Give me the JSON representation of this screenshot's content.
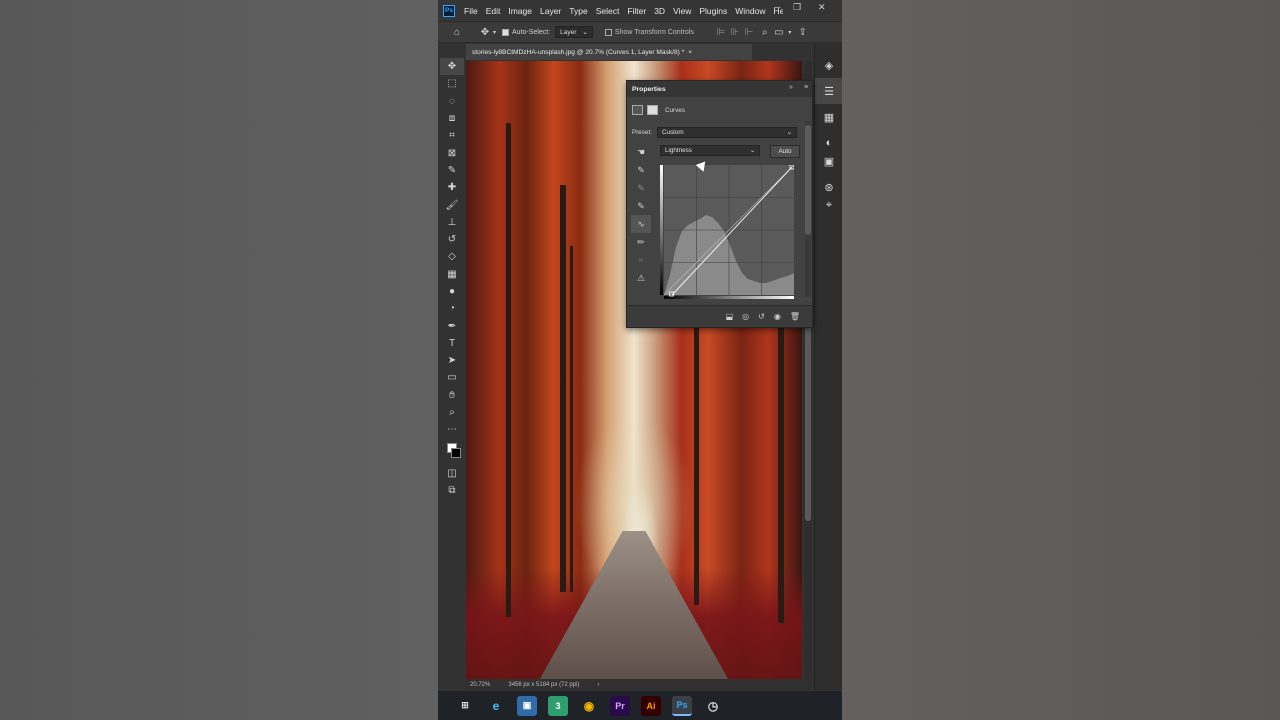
{
  "menubar": {
    "app_logo": "Ps",
    "items": [
      "File",
      "Edit",
      "Image",
      "Layer",
      "Type",
      "Select",
      "Filter",
      "3D",
      "View",
      "Plugins",
      "Window",
      "Help"
    ],
    "minimize": "─",
    "restore": "❐",
    "close": "✕"
  },
  "options": {
    "auto_select_label": "Auto-Select:",
    "auto_select_checked": true,
    "target_value": "Layer",
    "show_transform_label": "Show Transform Controls",
    "show_transform_checked": false
  },
  "document": {
    "tab_title": "stories-ly8BCtMDzHA-unsplash.jpg @ 20.7% (Curves 1, Layer Mask/8) *",
    "close": "×"
  },
  "status": {
    "zoom": "20.72%",
    "dimensions": "3456 px x 5184 px (72 ppi)",
    "arrow": "›"
  },
  "properties": {
    "title": "Properties",
    "panel_label": "Curves",
    "preset_label": "Preset:",
    "preset_value": "Custom",
    "channel_value": "Lightness",
    "auto_label": "Auto"
  },
  "colors": {
    "accent": "#31a8ff",
    "panel_bg": "#424242",
    "window_bg": "#323232"
  },
  "toolbar_icons": [
    "move-icon",
    "marquee-icon",
    "lasso-icon",
    "object-select-icon",
    "crop-icon",
    "frame-icon",
    "eyedropper-icon",
    "healing-icon",
    "brush-icon",
    "stamp-icon",
    "history-brush-icon",
    "eraser-icon",
    "gradient-icon",
    "blur-icon",
    "dodge-icon",
    "pen-icon",
    "type-icon",
    "path-select-icon",
    "rectangle-icon",
    "hand-icon",
    "zoom-icon",
    "more-icon"
  ],
  "taskbar": {
    "items": [
      {
        "name": "task-view-icon",
        "glyph": "⊞"
      },
      {
        "name": "edge-icon",
        "glyph": "e"
      },
      {
        "name": "app-icon",
        "glyph": "▣"
      },
      {
        "name": "app3-icon",
        "glyph": "3"
      },
      {
        "name": "chrome-icon",
        "glyph": "◉"
      },
      {
        "name": "premiere-icon",
        "glyph": "Pr"
      },
      {
        "name": "illustrator-icon",
        "glyph": "Ai"
      },
      {
        "name": "photoshop-icon",
        "glyph": "Ps"
      },
      {
        "name": "clock-app-icon",
        "glyph": "◷"
      }
    ]
  }
}
